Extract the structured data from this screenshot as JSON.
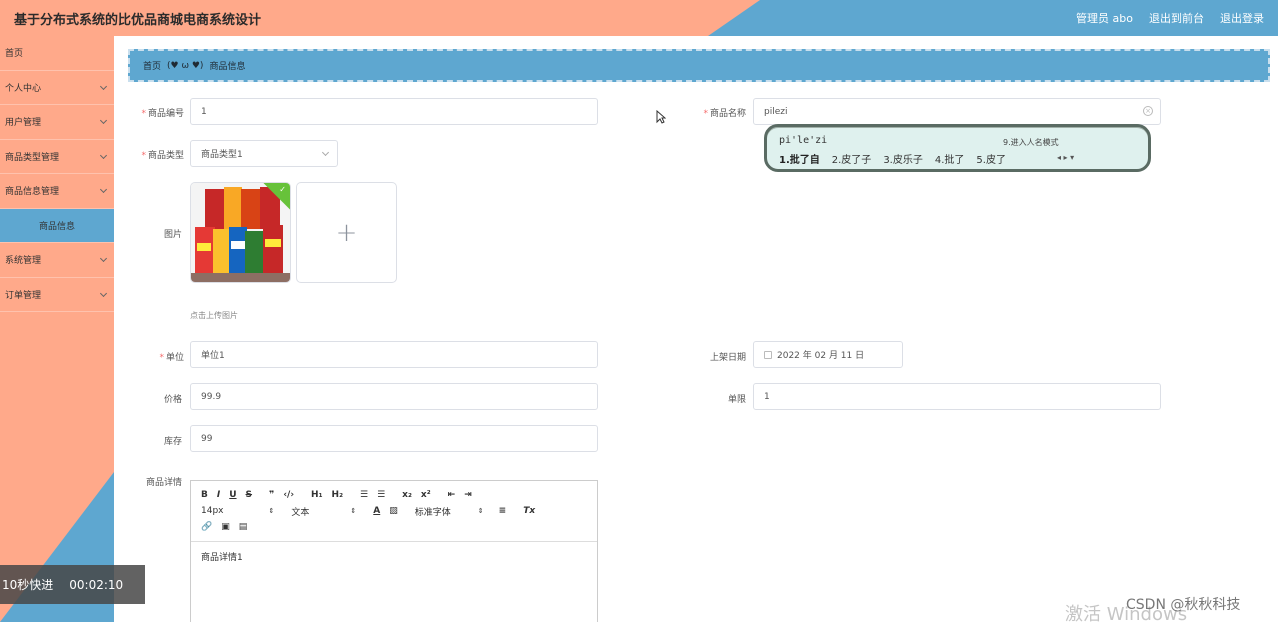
{
  "header": {
    "title": "基于分布式系统的比优品商城电商系统设计",
    "admin": "管理员 abo",
    "to_front": "退出到前台",
    "logout": "退出登录"
  },
  "sidebar": {
    "items": [
      {
        "label": "首页",
        "expandable": false
      },
      {
        "label": "个人中心",
        "expandable": true
      },
      {
        "label": "用户管理",
        "expandable": true
      },
      {
        "label": "商品类型管理",
        "expandable": true
      },
      {
        "label": "商品信息管理",
        "expandable": true
      },
      {
        "label": "商品信息",
        "expandable": false,
        "active": true
      },
      {
        "label": "系统管理",
        "expandable": true
      },
      {
        "label": "订单管理",
        "expandable": true
      }
    ]
  },
  "breadcrumb": {
    "home": "首页",
    "emoji": "(♥ ω ♥)",
    "current": "商品信息"
  },
  "form": {
    "product_no": {
      "label": "商品编号",
      "value": "1"
    },
    "product_name": {
      "label": "商品名称",
      "value": "pilezi"
    },
    "product_type": {
      "label": "商品类型",
      "value": "商品类型1"
    },
    "image": {
      "label": "图片",
      "hint": "点击上传图片"
    },
    "unit": {
      "label": "单位",
      "value": "单位1"
    },
    "listing_date": {
      "label": "上架日期",
      "value": "2022 年 02 月 11 日"
    },
    "price": {
      "label": "价格",
      "value": "99.9"
    },
    "limit": {
      "label": "单限",
      "value": "1"
    },
    "stock": {
      "label": "库存",
      "value": "99"
    },
    "details": {
      "label": "商品详情",
      "content": "商品详情1"
    }
  },
  "editor": {
    "font_size": "14px",
    "paragraph": "文本",
    "font_family": "标准字体"
  },
  "ime": {
    "composition": "pi'le'zi",
    "mode_hint": "9.进入人名模式",
    "candidates": [
      "1.批了自",
      "2.皮了子",
      "3.皮乐子",
      "4.批了",
      "5.皮了"
    ]
  },
  "video": {
    "skip": "10秒快进",
    "time": "00:02:10"
  },
  "watermark": {
    "activate": "激活 Windows",
    "csdn": "CSDN @秋秋科技"
  },
  "colors": {
    "peach": "#ffa98a",
    "blue": "#5ea7d0",
    "required": "#f56c6c"
  }
}
